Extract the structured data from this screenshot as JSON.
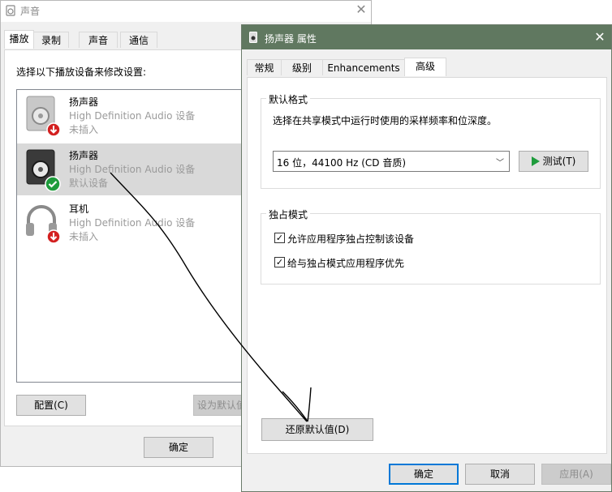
{
  "sound_window": {
    "title": "声音",
    "close_glyph": "✕",
    "tabs": [
      {
        "label": "播放",
        "active": true
      },
      {
        "label": "录制",
        "active": false
      },
      {
        "label": "声音",
        "active": false
      },
      {
        "label": "通信",
        "active": false
      }
    ],
    "instruction": "选择以下播放设备来修改设置:",
    "devices": [
      {
        "name": "扬声器",
        "description": "High Definition Audio 设备",
        "status": "未插入",
        "icon": "speaker-icon",
        "badge": "unplugged-arrow-icon",
        "selected": false
      },
      {
        "name": "扬声器",
        "description": "High Definition Audio 设备",
        "status": "默认设备",
        "icon": "speaker-icon",
        "badge": "default-check-icon",
        "selected": true
      },
      {
        "name": "耳机",
        "description": "High Definition Audio 设备",
        "status": "未插入",
        "icon": "headphones-icon",
        "badge": "unplugged-arrow-icon",
        "selected": false
      }
    ],
    "configure_button": "配置(C)",
    "set_default_button": "设为默认值",
    "ok_button": "确定"
  },
  "properties_window": {
    "title": "扬声器 属性",
    "close_glyph": "✕",
    "tabs": [
      {
        "label": "常规",
        "active": false
      },
      {
        "label": "级别",
        "active": false
      },
      {
        "label": "Enhancements",
        "active": false
      },
      {
        "label": "高级",
        "active": true
      }
    ],
    "default_format": {
      "group_title": "默认格式",
      "description": "选择在共享模式中运行时使用的采样频率和位深度。",
      "selected_value": "16 位，44100 Hz (CD 音质)",
      "dropdown_arrow": "﹀",
      "test_button": "测试(T)"
    },
    "exclusive_mode": {
      "group_title": "独占模式",
      "options": [
        {
          "label": "允许应用程序独占控制该设备",
          "checked": true
        },
        {
          "label": "给与独占模式应用程序优先",
          "checked": true
        }
      ]
    },
    "restore_defaults_button": "还原默认值(D)",
    "ok_button": "确定",
    "cancel_button": "取消",
    "apply_button": "应用(A)"
  },
  "colors": {
    "title_bar_active": "#607860",
    "accent": "#0078d7",
    "selection": "#d9d9d9",
    "check_green": "#1e9c3c",
    "badge_red": "#d32020"
  }
}
